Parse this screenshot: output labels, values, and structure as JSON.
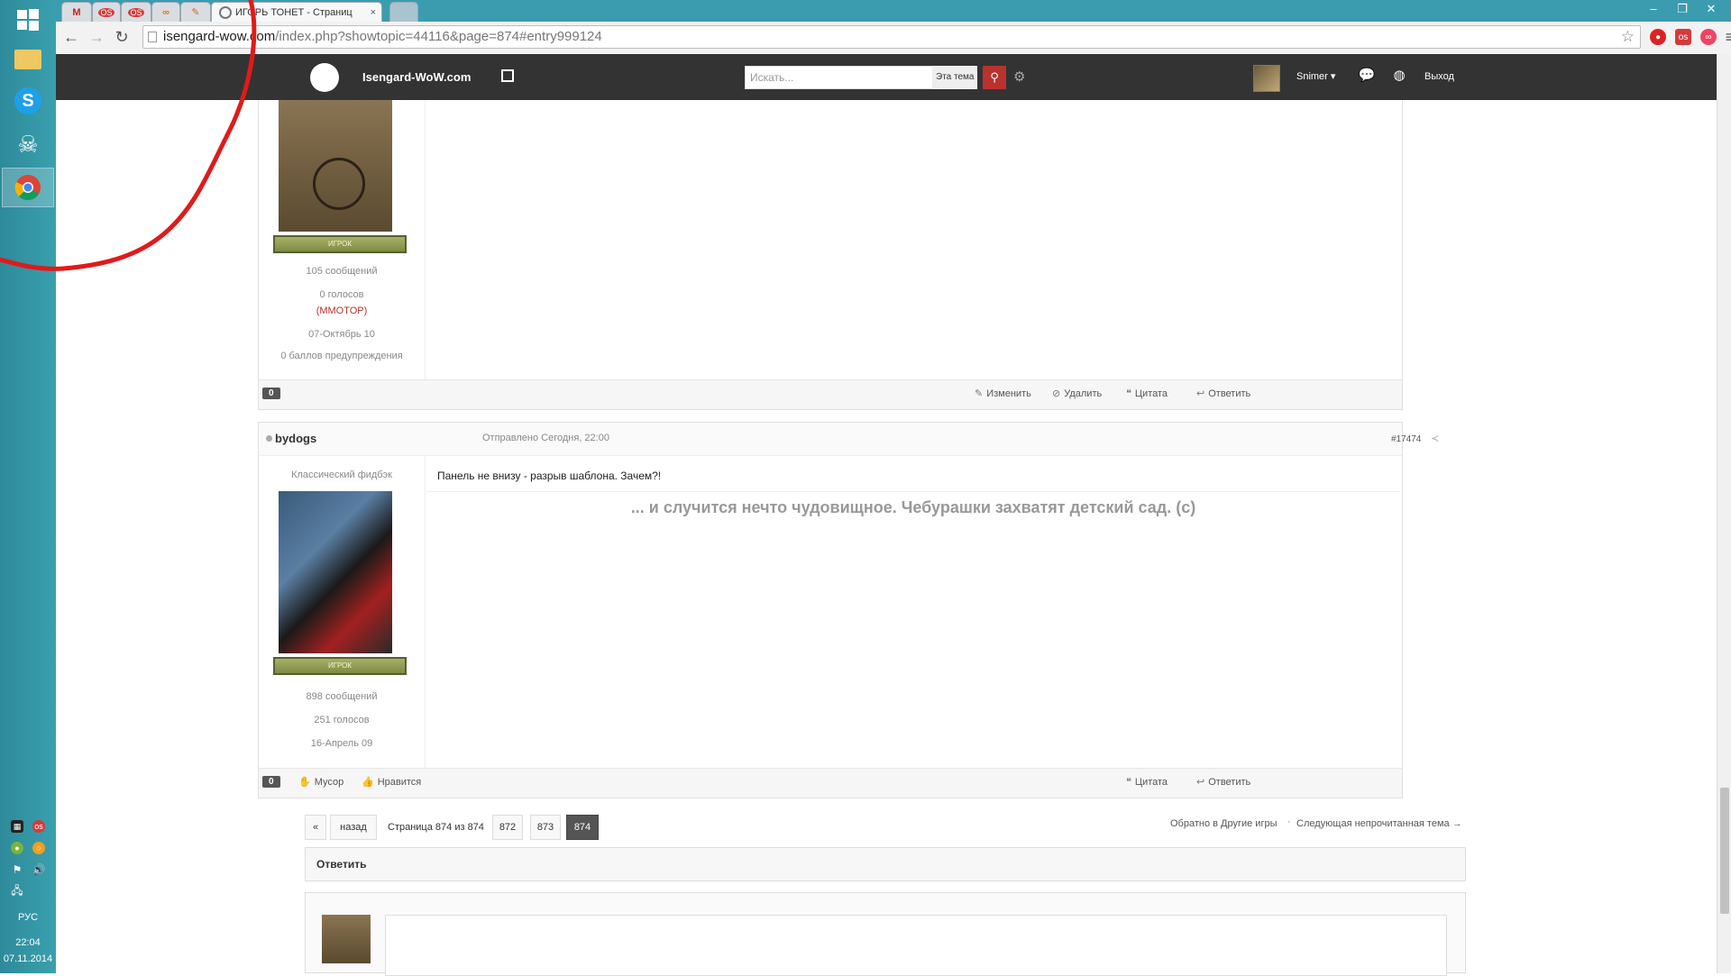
{
  "browser": {
    "tabs": [
      {
        "label": "M"
      },
      {
        "label": "OS"
      },
      {
        "label": "OS"
      },
      {
        "label": "∞"
      },
      {
        "label": "✎"
      },
      {
        "label": "ИГОРЬ ТОНЕТ - Страниц"
      }
    ],
    "tab_close": "×",
    "url_host": "isengard-wow.com",
    "url_path": "/index.php?showtopic=44116&page=874#entry999124",
    "win_min": "–",
    "win_max": "❐",
    "win_close": "✕"
  },
  "site": {
    "title": "Isengard-WoW.com",
    "search_placeholder": "Искать...",
    "search_scope": "Эта тема",
    "user": "Snimer",
    "logout": "Выход"
  },
  "post1": {
    "rank": "ИГРОК",
    "posts": "105 сообщений",
    "votes": "0 голосов",
    "tag": "(MMOTOP)",
    "joined": "07-Октябрь 10",
    "warnings": "0 баллов предупреждения",
    "rep": "0",
    "actions": [
      "Изменить",
      "Удалить",
      "Цитата",
      "Ответить"
    ]
  },
  "post2": {
    "author": "bydogs",
    "posted": "Отправлено Сегодня, 22:00",
    "number": "#17474",
    "title": "Классический фидбэк",
    "rank": "ИГРОК",
    "posts": "898 сообщений",
    "votes": "251 голосов",
    "joined": "16-Апрель 09",
    "body": "Панель не внизу - разрыв шаблона. Зачем?!",
    "signature": "... и случится нечто чудовищное. Чебурашки захватят детский сад. (с)",
    "rep": "0",
    "actions_left": [
      "Мусор",
      "Нравится"
    ],
    "actions_right": [
      "Цитата",
      "Ответить"
    ]
  },
  "pagination": {
    "first": "«",
    "prev": "назад",
    "info": "Страница 874 из 874",
    "pages": [
      "872",
      "873",
      "874"
    ],
    "back_link": "Обратно в Другие игры",
    "next_unread": "Следующая непрочитанная тема →"
  },
  "reply": {
    "title": "Ответить"
  },
  "taskbar": {
    "lang": "РУС",
    "time": "22:04",
    "date": "07.11.2014"
  }
}
